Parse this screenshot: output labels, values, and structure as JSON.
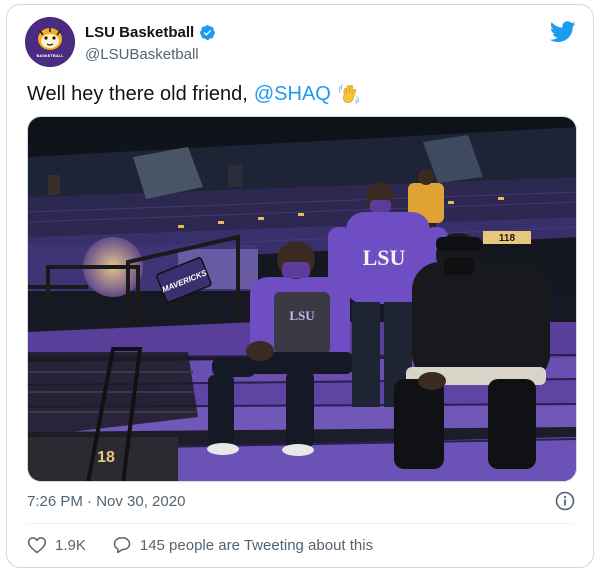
{
  "account": {
    "display_name": "LSU Basketball",
    "handle": "@LSUBasketball",
    "avatar_text": "BASKETBALL",
    "verified": true
  },
  "tweet": {
    "text": "Well hey there old friend,",
    "mention": "@SHAQ",
    "emoji": "waving-hand"
  },
  "photo": {
    "sign_text": "MAVERICKS",
    "shirt_text": "LSU",
    "hoodie_text": "LSU",
    "section_number": "118",
    "row_number": "18"
  },
  "meta": {
    "timestamp": "7:26 PM · Nov 30, 2020"
  },
  "actions": {
    "likes": "1.9K",
    "tweeting_text": "145 people are Tweeting about this"
  },
  "colors": {
    "brand_blue": "#1d9bf0",
    "lsu_purple": "#4b2b7f",
    "text_secondary": "#536471"
  },
  "icons": [
    "verified-badge-icon",
    "twitter-bird-icon",
    "info-icon",
    "heart-icon",
    "reply-bubble-icon",
    "waving-hand-icon"
  ]
}
